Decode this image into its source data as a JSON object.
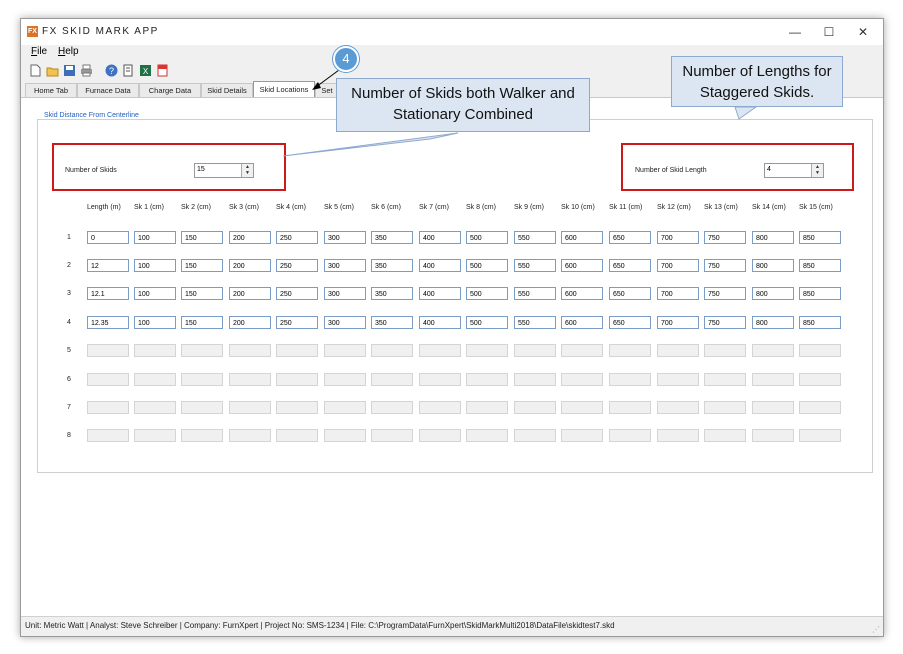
{
  "window": {
    "title": "FX SKID MARK APP",
    "icon_text": "FX",
    "controls": {
      "minimize": "—",
      "maximize": "☐",
      "close": "✕"
    }
  },
  "menu": {
    "items": [
      "File",
      "Help"
    ]
  },
  "toolbar": {
    "icons": [
      "new-file-icon",
      "open-folder-icon",
      "save-icon",
      "print-icon",
      "help-icon",
      "report-icon",
      "excel-icon",
      "pdf-icon"
    ]
  },
  "tabs": {
    "items": [
      "Home Tab",
      "Furnace Data",
      "Charge Data",
      "Skid Details",
      "Skid Locations",
      "Set"
    ],
    "active": "Skid Locations"
  },
  "skid_panel": {
    "group_title": "Skid Distance From Centerline",
    "num_skids_label": "Number of Skids",
    "num_skids_value": "15",
    "num_lengths_label": "Number of Skid Length",
    "num_lengths_value": "4"
  },
  "grid": {
    "headers": [
      "Length (m)",
      "Sk 1 (cm)",
      "Sk 2 (cm)",
      "Sk 3 (cm)",
      "Sk 4 (cm)",
      "Sk 5 (cm)",
      "Sk 6 (cm)",
      "Sk 7 (cm)",
      "Sk 8 (cm)",
      "Sk 9 (cm)",
      "Sk 10 (cm)",
      "Sk 11 (cm)",
      "Sk 12 (cm)",
      "Sk 13 (cm)",
      "Sk 14 (cm)",
      "Sk 15 (cm)"
    ],
    "rows": [
      {
        "label": "1",
        "values": [
          "0",
          "100",
          "150",
          "200",
          "250",
          "300",
          "350",
          "400",
          "500",
          "550",
          "600",
          "650",
          "700",
          "750",
          "800",
          "850"
        ]
      },
      {
        "label": "2",
        "values": [
          "12",
          "100",
          "150",
          "200",
          "250",
          "300",
          "350",
          "400",
          "500",
          "550",
          "600",
          "650",
          "700",
          "750",
          "800",
          "850"
        ]
      },
      {
        "label": "3",
        "values": [
          "12.1",
          "100",
          "150",
          "200",
          "250",
          "300",
          "350",
          "400",
          "500",
          "550",
          "600",
          "650",
          "700",
          "750",
          "800",
          "850"
        ]
      },
      {
        "label": "4",
        "values": [
          "12.35",
          "100",
          "150",
          "200",
          "250",
          "300",
          "350",
          "400",
          "500",
          "550",
          "600",
          "650",
          "700",
          "750",
          "800",
          "850"
        ]
      },
      {
        "label": "5",
        "values": []
      },
      {
        "label": "6",
        "values": []
      },
      {
        "label": "7",
        "values": []
      },
      {
        "label": "8",
        "values": []
      }
    ]
  },
  "statusbar": {
    "text": "Unit: Metric Watt  | Analyst: Steve Schreiber  | Company: FurnXpert  | Project No: SMS-1234  | File: C:\\ProgramData\\FurnXpert\\SkidMarkMulti2018\\DataFile\\skidtest7.skd"
  },
  "annotations": {
    "badge": "4",
    "callout_skids": "Number of Skids both Walker and Stationary Combined",
    "callout_lengths": "Number of Lengths for Staggered Skids.",
    "color": "#5b9bd5"
  }
}
